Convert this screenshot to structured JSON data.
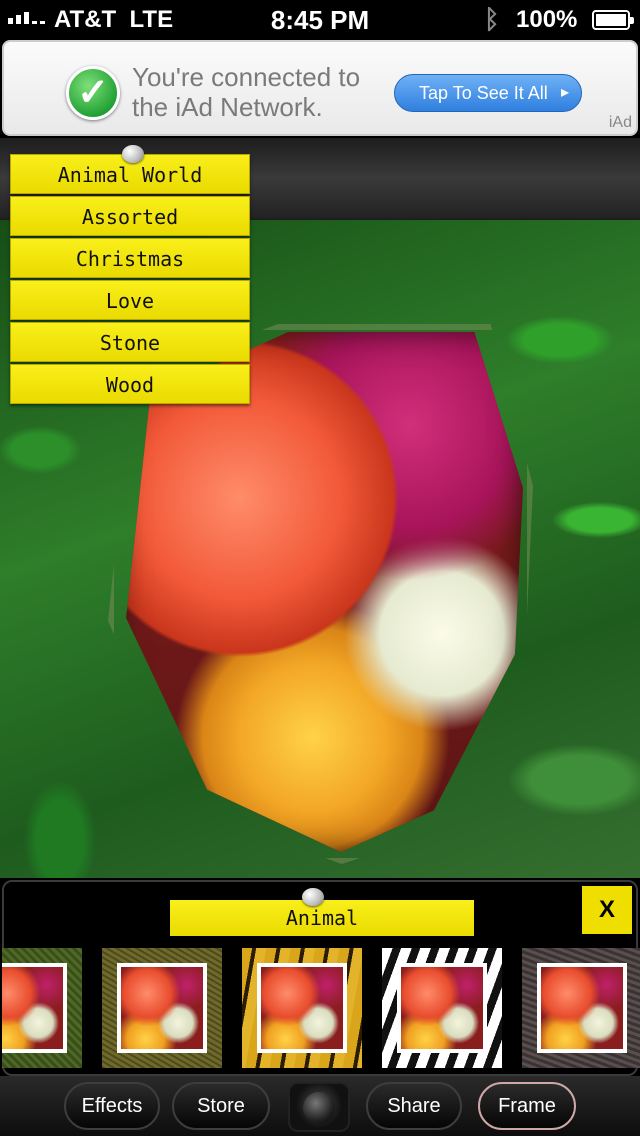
{
  "status_bar": {
    "carrier": "AT&T",
    "network": "LTE",
    "time": "8:45 PM",
    "battery_percent": "100%",
    "signal_bars": 5,
    "bluetooth_icon": "bluetooth-icon"
  },
  "ad_banner": {
    "message": "You're connected to the iAd Network.",
    "button_label": "Tap To See It All",
    "brand": "iAd",
    "icon": "checkmark-icon"
  },
  "categories": [
    "Animal World",
    "Assorted",
    "Christmas",
    "Love",
    "Stone",
    "Wood"
  ],
  "frame_panel": {
    "title": "Animal",
    "close_label": "X",
    "thumbnails": [
      "moss",
      "leather",
      "tiger",
      "zebra",
      "fur"
    ]
  },
  "toolbar": {
    "effects": "Effects",
    "store": "Store",
    "share": "Share",
    "frame": "Frame",
    "camera_icon": "camera-icon"
  },
  "colors": {
    "accent_yellow": "#f2e30b",
    "panel_bg": "#000000"
  }
}
